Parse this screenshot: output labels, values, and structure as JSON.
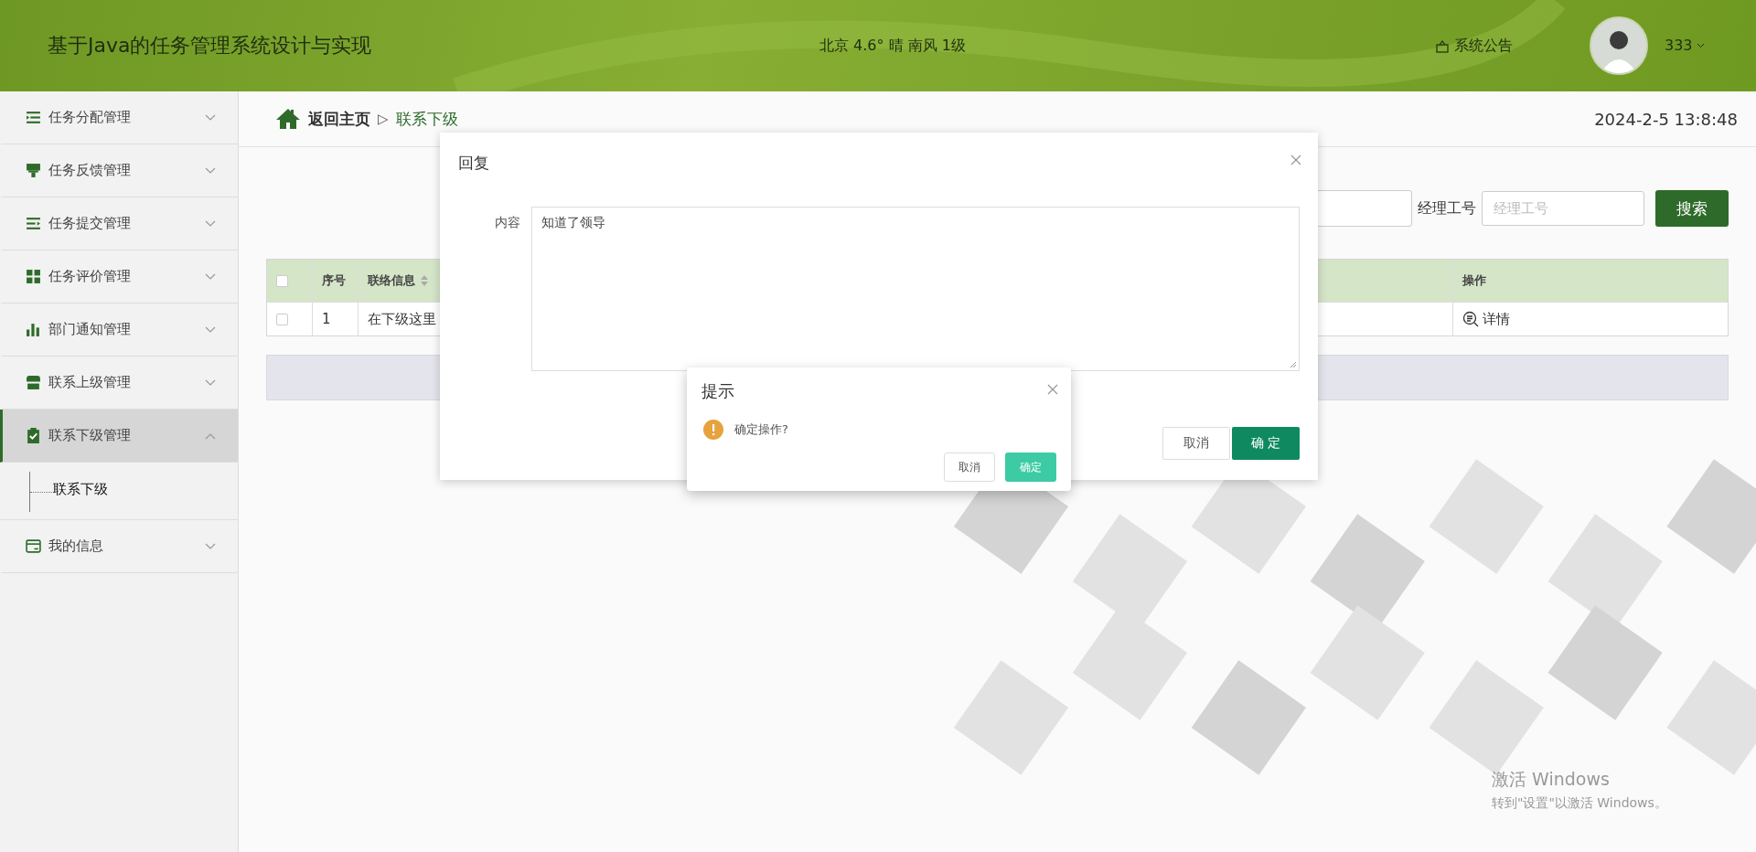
{
  "header": {
    "title": "基于Java的任务管理系统设计与实现",
    "weather": "北京  4.6°  晴  南风  1级",
    "notice": "系统公告",
    "user": "333"
  },
  "sidebar": {
    "items": [
      {
        "label": "任务分配管理",
        "expanded": false,
        "selected": false
      },
      {
        "label": "任务反馈管理",
        "expanded": false,
        "selected": false
      },
      {
        "label": "任务提交管理",
        "expanded": false,
        "selected": false
      },
      {
        "label": "任务评价管理",
        "expanded": false,
        "selected": false
      },
      {
        "label": "部门通知管理",
        "expanded": false,
        "selected": false
      },
      {
        "label": "联系上级管理",
        "expanded": false,
        "selected": false
      },
      {
        "label": "联系下级管理",
        "expanded": true,
        "selected": true,
        "children": [
          {
            "label": "联系下级",
            "selected": true
          }
        ]
      },
      {
        "label": "我的信息",
        "expanded": false,
        "selected": false
      }
    ]
  },
  "breadcrumb": {
    "home": "返回主页",
    "separator": "▷",
    "current": "联系下级"
  },
  "datetime": "2024-2-5 13:8:48",
  "search": {
    "field_label": "经理工号",
    "placeholder": "经理工号",
    "button": "搜索"
  },
  "table": {
    "all_checked": false,
    "columns": [
      "序号",
      "联络信息",
      "操作"
    ],
    "rows": [
      {
        "checked": false,
        "cells": [
          "1",
          "在下级这里"
        ],
        "action": "详情"
      }
    ]
  },
  "reply_dialog": {
    "title": "回复",
    "field_label": "内容",
    "value": "知道了领导",
    "buttons": [
      "取消",
      "确 定"
    ]
  },
  "confirm_dialog": {
    "title": "提示",
    "message": "确定操作?",
    "buttons": [
      "取消",
      "确定"
    ]
  },
  "os_notice": {
    "title": "激活 Windows",
    "text": "转到\"设置\"以激活 Windows。"
  }
}
